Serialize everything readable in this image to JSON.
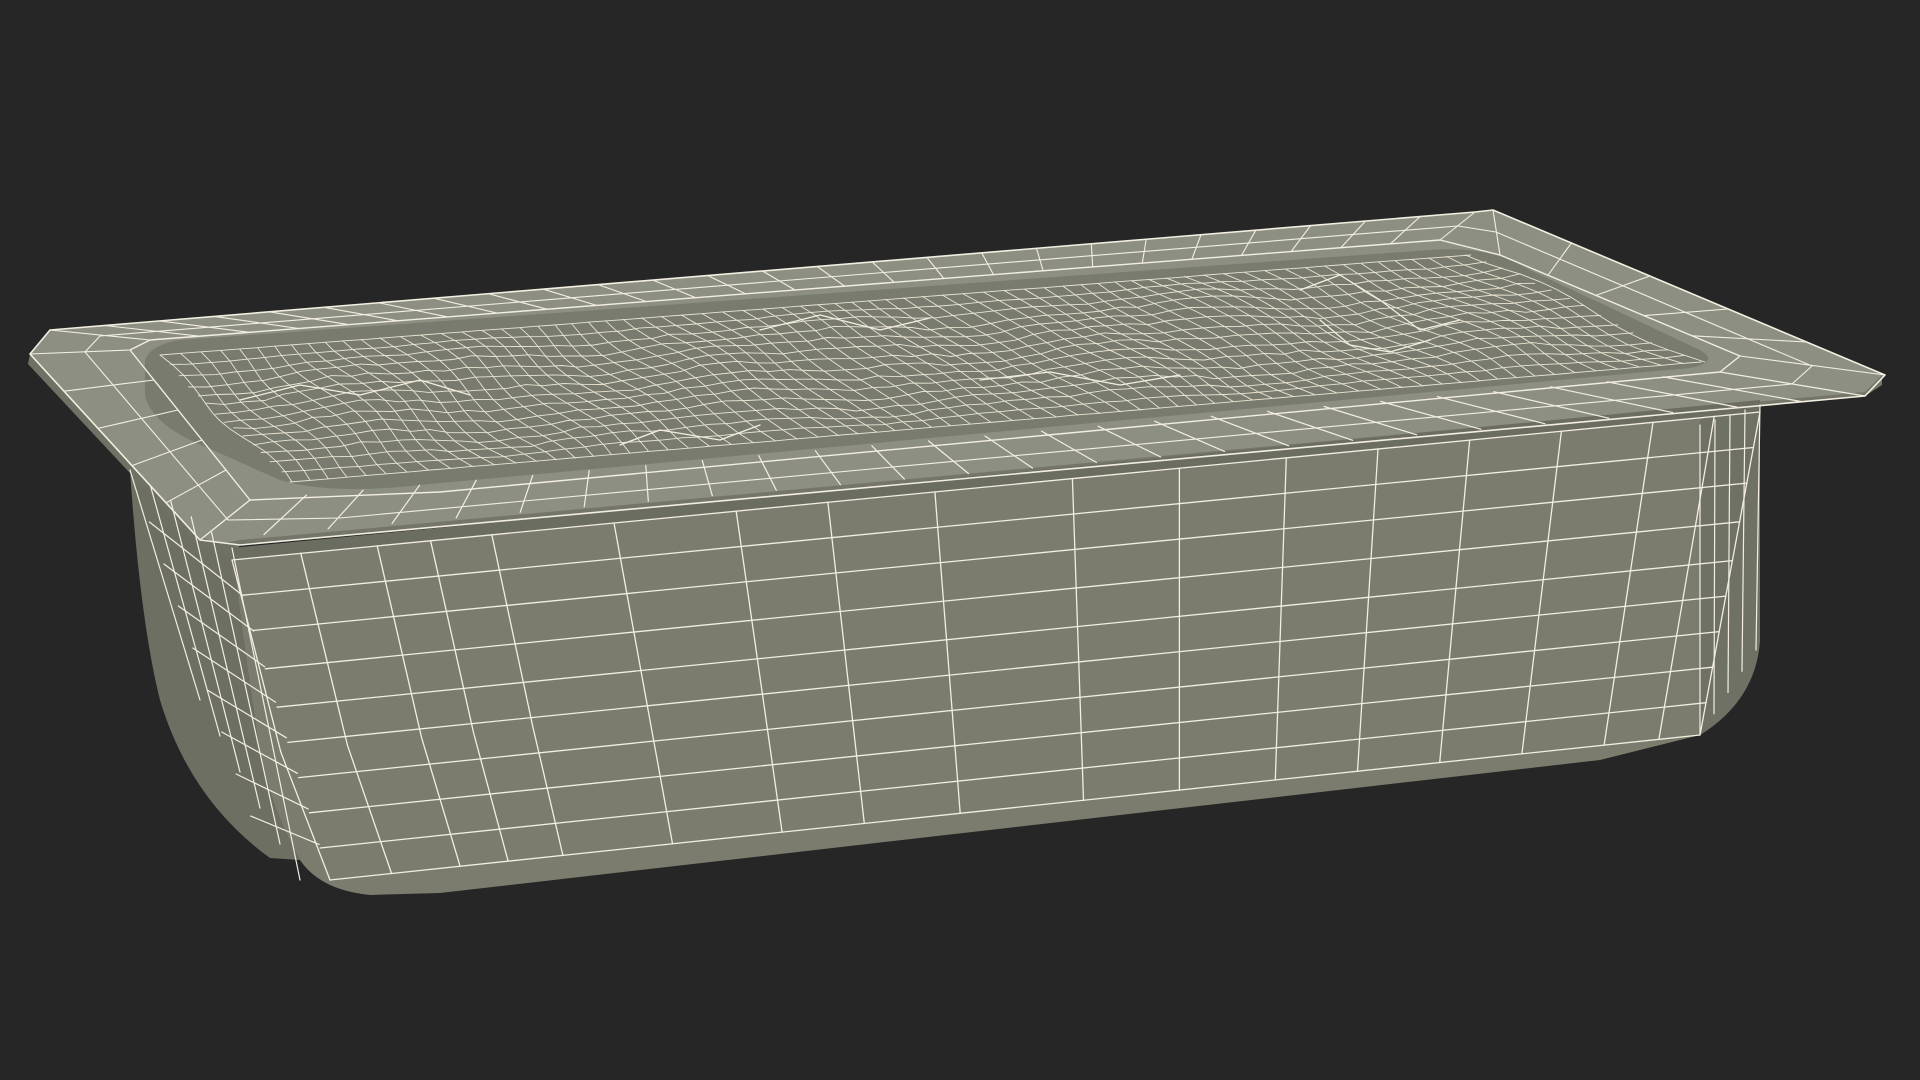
{
  "scene": {
    "subject": "tray-wireframe-render",
    "colors": {
      "background": "#262626",
      "body_fill": "#7b7b6e",
      "body_shadow": "#6a6a5f",
      "rim_fill": "#85867a",
      "rim_top": "#8e8f83",
      "well_fill": "#77786c",
      "wire": "#f2efe0",
      "wire_dense": "#e9e5d2"
    }
  }
}
